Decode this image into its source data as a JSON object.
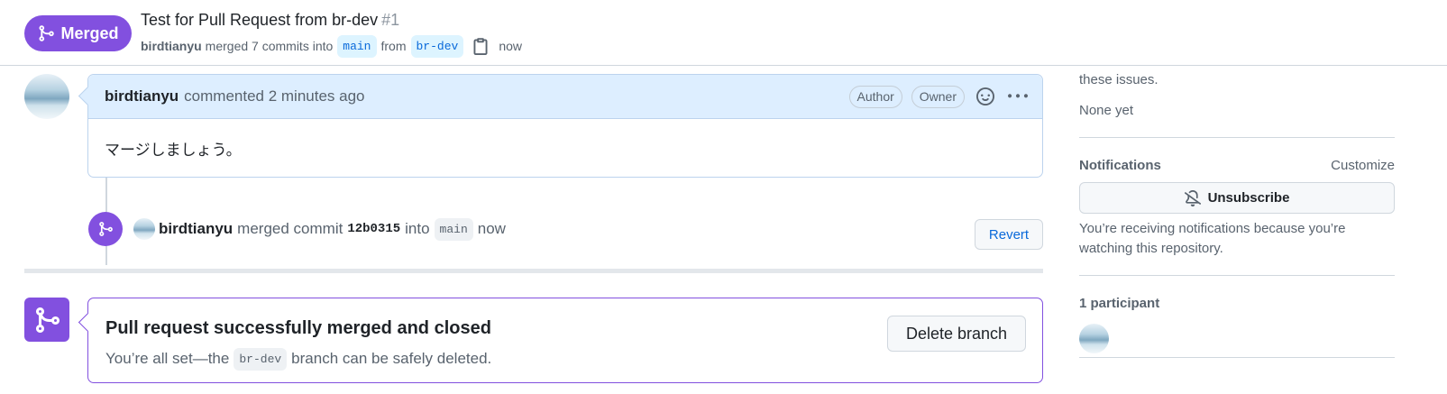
{
  "header": {
    "state_label": "Merged",
    "title": "Test for Pull Request from br-dev",
    "number": "#1",
    "author": "birdtianyu",
    "merged_text": "merged 7 commits into",
    "base_branch": "main",
    "from_text": "from",
    "head_branch": "br-dev",
    "time": "now"
  },
  "comment": {
    "author": "birdtianyu",
    "action": "commented 2 minutes ago",
    "badges": [
      "Author",
      "Owner"
    ],
    "body": "マージしましょう。"
  },
  "merge_event": {
    "author": "birdtianyu",
    "text": "merged commit",
    "sha": "12b0315",
    "into_text": "into",
    "branch": "main",
    "time": "now",
    "revert_label": "Revert"
  },
  "merged_box": {
    "title": "Pull request successfully merged and closed",
    "sub_before": "You’re all set—the",
    "branch": "br-dev",
    "sub_after": "branch can be safely deleted.",
    "delete_label": "Delete branch"
  },
  "sidebar": {
    "dev_text_partial": "these issues.",
    "dev_value": "None yet",
    "notifications": {
      "heading": "Notifications",
      "customize": "Customize",
      "unsubscribe": "Unsubscribe",
      "reason": "You’re receiving notifications because you’re watching this repository."
    },
    "participants": {
      "heading": "1 participant"
    }
  },
  "colors": {
    "merged_purple": "#8250df",
    "link_blue": "#0969da",
    "comment_header": "#ddeeff"
  }
}
